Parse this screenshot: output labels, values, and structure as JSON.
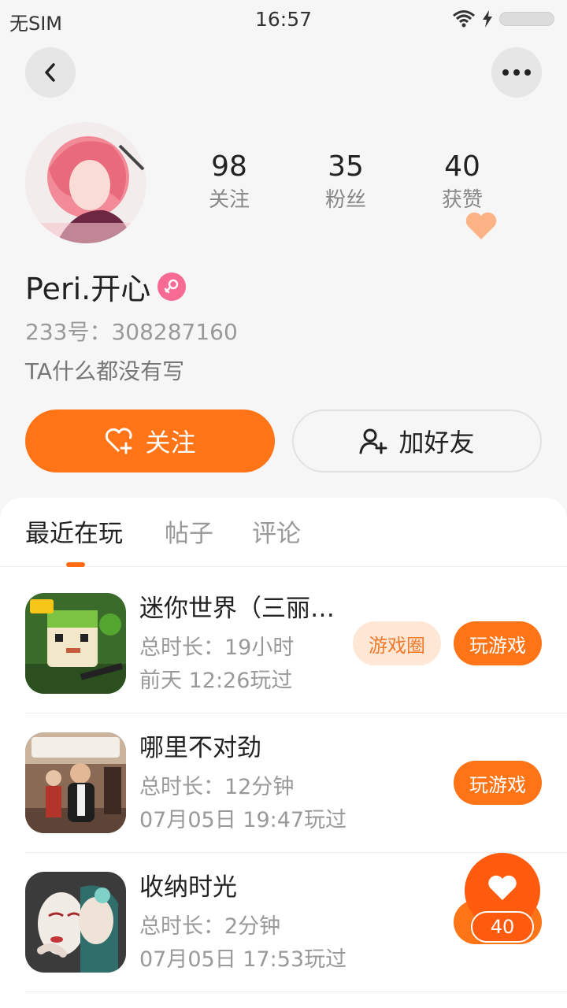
{
  "status_bar": {
    "carrier": "无SIM",
    "time": "16:57"
  },
  "profile": {
    "stats": [
      {
        "value": "98",
        "label": "关注"
      },
      {
        "value": "35",
        "label": "粉丝"
      },
      {
        "value": "40",
        "label": "获赞"
      }
    ],
    "name": "Peri.开心",
    "uid": "233号：308287160",
    "bio": "TA什么都没有写",
    "follow_label": "关注",
    "add_friend_label": "加好友"
  },
  "tabs": [
    {
      "label": "最近在玩",
      "active": true
    },
    {
      "label": "帖子",
      "active": false
    },
    {
      "label": "评论",
      "active": false
    }
  ],
  "games": [
    {
      "title": "迷你世界（三丽…",
      "duration": "总时长：19小时",
      "last_played": "前天 12:26玩过",
      "circle_label": "游戏圈",
      "play_label": "玩游戏"
    },
    {
      "title": "哪里不对劲",
      "duration": "总时长：12分钟",
      "last_played": "07月05日 19:47玩过",
      "play_label": "玩游戏"
    },
    {
      "title": "收纳时光",
      "duration": "总时长：2分钟",
      "last_played": "07月05日 17:53玩过"
    }
  ],
  "float_like": {
    "count": "40"
  },
  "colors": {
    "accent": "#ff7417",
    "accent_dark": "#ff5b0f",
    "gender": "#f76a93",
    "pill_light": "#ffe7d6"
  }
}
